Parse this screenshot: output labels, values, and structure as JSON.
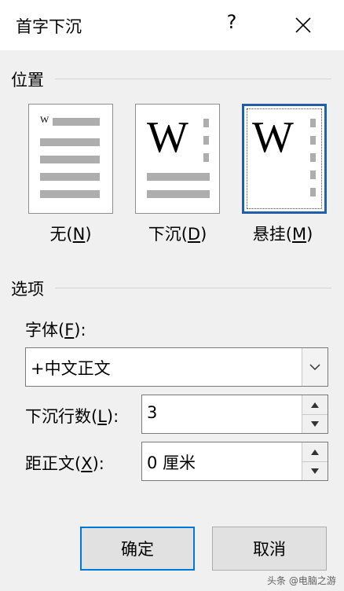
{
  "title": "首字下沉",
  "help_label": "?",
  "position": {
    "section_label": "位置",
    "options": [
      {
        "label_pre": "无(",
        "key": "N",
        "label_post": ")",
        "selected": false
      },
      {
        "label_pre": "下沉(",
        "key": "D",
        "label_post": ")",
        "selected": false
      },
      {
        "label_pre": "悬挂(",
        "key": "M",
        "label_post": ")",
        "selected": true
      }
    ],
    "sample_letter": "W"
  },
  "options": {
    "section_label": "选项",
    "font": {
      "label_pre": "字体(",
      "key": "F",
      "label_post": "):",
      "value": "+中文正文"
    },
    "lines": {
      "label_pre": "下沉行数(",
      "key": "L",
      "label_post": "):",
      "value": "3"
    },
    "distance": {
      "label_pre": "距正文(",
      "key": "X",
      "label_post": "):",
      "value": "0 厘米"
    }
  },
  "buttons": {
    "ok": "确定",
    "cancel": "取消"
  },
  "watermark": "头条 @电脑之游",
  "colors": {
    "selection_border": "#1f5ea8",
    "default_button_border": "#0078d7",
    "background": "#f0f0f0"
  }
}
